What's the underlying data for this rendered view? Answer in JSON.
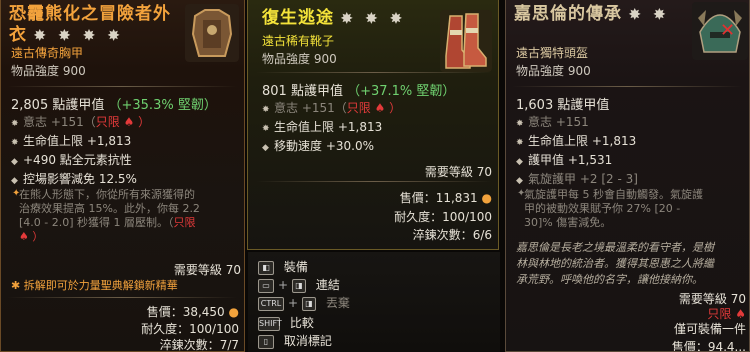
{
  "p1": {
    "title_line1": "恐龗熊化之冒險者外",
    "title_line2": "衣",
    "stars": "✸ ✸ ✸ ✸",
    "rarity": "遠古傳奇胸甲",
    "power": "物品強度 900",
    "armor_value": "2,805 點護甲值",
    "armor_pct": "（+35.3% 堅韌）",
    "stat1": "意志 +151（",
    "stat1_tag": "只限",
    "stat2": "生命值上限 +1,813",
    "stat3": "+490 點全元素抗性",
    "stat4": "控場影響減免 12.5%",
    "aspect_l1": "在熊人形態下，你從所有來源獲得的",
    "aspect_l2": "治療效果提高 15%。此外，你每 2.2",
    "aspect_l3": "[4.0 - 2.0] 秒獲得 1 層壓制。（",
    "aspect_tag": "只限",
    "req_level": "需要等級 70",
    "salvage": "拆解即可於力量聖典解鎖新精華",
    "sell_label": "售價：",
    "sell_value": "38,450",
    "dur_label": "耐久度：",
    "dur_value": "100/100",
    "temper_label": "淬鍊次數：",
    "temper_value": "7/7"
  },
  "p2": {
    "title": "復生逃途",
    "stars": "✸ ✸ ✸",
    "rarity": "遠古稀有靴子",
    "power": "物品強度 900",
    "armor_value": "801 點護甲值",
    "armor_pct": "（+37.1% 堅韌）",
    "stat1": "意志 +151（",
    "stat1_tag": "只限",
    "stat2": "生命值上限 +1,813",
    "stat3": "移動速度 +30.0%",
    "req_level": "需要等級 70",
    "sell_label": "售價：",
    "sell_value": "11,831",
    "dur_label": "耐久度：",
    "dur_value": "100/100",
    "temper_label": "淬鍊次數：",
    "temper_value": "6/6"
  },
  "menu": {
    "equip": "裝備",
    "link": "連結",
    "drop": "丟棄",
    "compare": "比較",
    "unmark": "取消標記",
    "ctrl": "CTRL",
    "shift": "SHIFT"
  },
  "p3": {
    "title": "嘉思倫的傳承",
    "stars": "✸ ✸",
    "rarity": "遠古獨特頭盔",
    "power": "物品強度 900",
    "armor_value": "1,603 點護甲值",
    "stat1": "意志 +151",
    "stat2": "生命值上限 +1,813",
    "stat3": "護甲值 +1,531",
    "stat4": "氣旋護甲 +2 [2 - 3]",
    "aspect_l1": "氣旋護甲每 5 秒會自動觸發。氣旋護",
    "aspect_l2": "甲的被動效果賦予你 27% [20 -",
    "aspect_l3": "30]% 傷害減免。",
    "flavor_l1": "嘉思倫是長老之境最溫柔的看守者，是樹",
    "flavor_l2": "林與林地的統治者。獲得其恩惠之人將繼",
    "flavor_l3": "承荒野。呼喚他的名字，讓他接納你。",
    "req_level": "需要等級 70",
    "class_only": "只限",
    "equip_one": "僅可裝備一件",
    "sell_partial": "售價：94,4..."
  },
  "colors": {
    "legendary": "#f2a23c",
    "rare": "#f4e33a",
    "unique": "#d9c7a0",
    "green": "#6fd06f",
    "red": "#e33a3a"
  }
}
